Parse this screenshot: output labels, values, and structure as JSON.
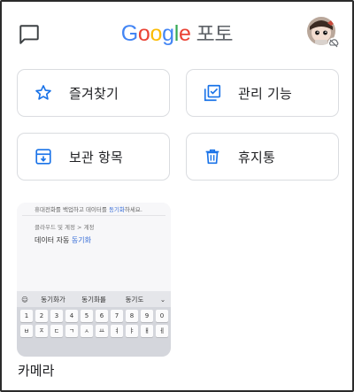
{
  "header": {
    "logo_letters": [
      {
        "ch": "G",
        "color": "#4285F4"
      },
      {
        "ch": "o",
        "color": "#EA4335"
      },
      {
        "ch": "o",
        "color": "#FBBC05"
      },
      {
        "ch": "g",
        "color": "#4285F4"
      },
      {
        "ch": "l",
        "color": "#34A853"
      },
      {
        "ch": "e",
        "color": "#EA4335"
      }
    ],
    "title_suffix": "포토",
    "message_icon": "chat-bubble-icon",
    "avatar_icon": "profile-avatar"
  },
  "tiles": [
    {
      "label": "즐겨찾기",
      "icon": "star-outline-icon"
    },
    {
      "label": "관리 기능",
      "icon": "checked-stack-icon"
    },
    {
      "label": "보관 항목",
      "icon": "archive-icon"
    },
    {
      "label": "휴지통",
      "icon": "trash-icon"
    }
  ],
  "album": {
    "title": "카메라",
    "thumbnail": {
      "line1_prefix": "휴대전화를 백업하고 데이터를",
      "line1_highlight": "동기화",
      "line1_suffix": "하세요.",
      "line2": "클라우드 및 계정 > 계정",
      "line3_prefix": "데이터 자동",
      "line3_highlight": "동기화",
      "suggestions": [
        "동기화가",
        "동기화를",
        "동기도"
      ],
      "keyboard_row1": [
        "1",
        "2",
        "3",
        "4",
        "5",
        "6",
        "7",
        "8",
        "9",
        "0"
      ],
      "keyboard_row2": [
        "ㅂ",
        "ㅈ",
        "ㄷ",
        "ㄱ",
        "ㅅ",
        "ㅛ",
        "ㅕ",
        "ㅑ",
        "ㅐ",
        "ㅔ"
      ]
    }
  },
  "colors": {
    "accent": "#1a73e8",
    "border": "#dadce0",
    "text": "#202124"
  }
}
